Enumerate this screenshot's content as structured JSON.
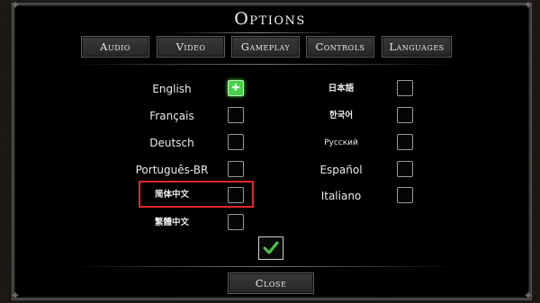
{
  "title": "Options",
  "tabs": [
    {
      "label": "Audio"
    },
    {
      "label": "Video"
    },
    {
      "label": "Gameplay"
    },
    {
      "label": "Controls"
    },
    {
      "label": "Languages"
    }
  ],
  "languages_left": [
    {
      "label": "English",
      "checked": true
    },
    {
      "label": "Français",
      "checked": false
    },
    {
      "label": "Deutsch",
      "checked": false
    },
    {
      "label": "Português-BR",
      "checked": false
    },
    {
      "label": "简体中文",
      "checked": false
    },
    {
      "label": "繁體中文",
      "checked": false
    }
  ],
  "languages_right": [
    {
      "label": "日本語",
      "checked": false
    },
    {
      "label": "한국어",
      "checked": false
    },
    {
      "label": "Русский",
      "checked": false
    },
    {
      "label": "Español",
      "checked": false
    },
    {
      "label": "Italiano",
      "checked": false
    }
  ],
  "confirm_icon": "checkmark-icon",
  "close_label": "Close",
  "colors": {
    "checked": "#49d04b",
    "highlight": "#e3262b",
    "confirm_check": "#4cc94c"
  }
}
